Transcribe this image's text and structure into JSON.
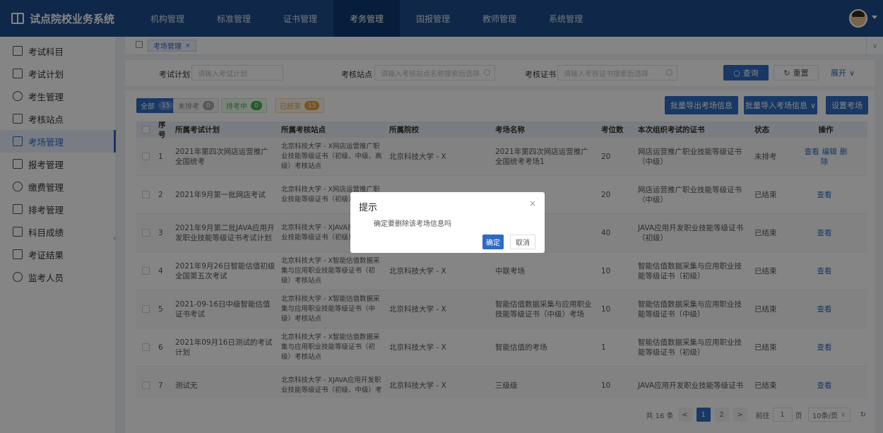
{
  "app": {
    "title": "试点院校业务系统"
  },
  "topnav": [
    "机构管理",
    "标准管理",
    "证书管理",
    "考务管理",
    "国报管理",
    "教师管理",
    "系统管理"
  ],
  "sidebar": [
    "考试科目",
    "考试计划",
    "考生管理",
    "考核站点",
    "考场管理",
    "报考管理",
    "缴费管理",
    "排考管理",
    "科目成绩",
    "考证结果",
    "监考人员"
  ],
  "tabs": {
    "active": "考场管理",
    "close": "×"
  },
  "filter": {
    "plan_label": "考试计划",
    "plan_placeholder": "请输入考试计划",
    "site_label": "考核站点",
    "site_placeholder": "请输入考核站点名称搜索后选择",
    "cert_label": "考核证书",
    "cert_placeholder": "请输入考核证书搜索后选择",
    "search": "查询",
    "reset": "重置",
    "expand": "展开"
  },
  "status_filters": [
    {
      "label": "全部",
      "count": "15"
    },
    {
      "label": "未排考",
      "count": "0"
    },
    {
      "label": "排考中",
      "count": "0"
    },
    {
      "label": "已结束",
      "count": "15"
    }
  ],
  "actions": {
    "export": "批量导出考场信息",
    "import": "批量导入考场信息",
    "setup": "设置考场"
  },
  "table": {
    "headers": [
      "序号",
      "所属考试计划",
      "所属考核站点",
      "所属院校",
      "考场名称",
      "考位数",
      "本次组织考试的证书",
      "状态",
      "操作"
    ],
    "rows": [
      {
        "no": "1",
        "plan": "2021年第四次网店运营推广全国统考",
        "site": "北京科技大学 - X网店运营推广职业技能等级证书（初级、中级、高级）考核站点",
        "school": "北京科技大学 - X",
        "room": "2021年第四次网店运营推广全国统考考场1",
        "seats": "20",
        "cert": "网店运营推广职业技能等级证书（中级）",
        "status": "未排考",
        "ops": [
          "查看",
          "编辑",
          "删除"
        ]
      },
      {
        "no": "2",
        "plan": "2021年9月第一批网店考试",
        "site": "北京科技大学 - X网店运营推广职业技能等级证书（初级）考核站点",
        "school": "",
        "room": "",
        "seats": "20",
        "cert": "网店运营推广职业技能等级证书（中级）",
        "status": "已结束",
        "ops": [
          "查看"
        ]
      },
      {
        "no": "3",
        "plan": "2021年9月第二批JAVA应用开发职业技能等级证书考试计划",
        "site": "北京科技大学 - XJAVA应用开发职业技能等级证书（初级）考核站点",
        "school": "",
        "room": "",
        "seats": "40",
        "cert": "JAVA应用开发职业技能等级证书（初级）",
        "status": "已结束",
        "ops": [
          "查看"
        ]
      },
      {
        "no": "4",
        "plan": "2021年9月26日智能估值初级全国第五次考试",
        "site": "北京科技大学 - X智能估值数据采集与应用职业技能等级证书（初级）考核站点",
        "school": "北京科技大学 - X",
        "room": "中联考场",
        "seats": "10",
        "cert": "智能估值数据采集与应用职业技能等级证书（初级）",
        "status": "已结束",
        "ops": [
          "查看"
        ]
      },
      {
        "no": "5",
        "plan": "2021-09-16日中级智能估值证书考试",
        "site": "北京科技大学 - X智能估值数据采集与应用职业技能等级证书（中级）考核站点",
        "school": "北京科技大学 - X",
        "room": "智能估值数据采集与应用职业技能等级证书（中级）考场",
        "seats": "10",
        "cert": "智能估值数据采集与应用职业技能等级证书（中级）",
        "status": "已结束",
        "ops": [
          "查看"
        ]
      },
      {
        "no": "6",
        "plan": "2021年09月16日测试的考试计划",
        "site": "北京科技大学 - X智能估值数据采集与应用职业技能等级证书（初级）考核站点",
        "school": "北京科技大学 - X",
        "room": "智能估值的考场",
        "seats": "1",
        "cert": "智能估值数据采集与应用职业技能等级证书（初级）",
        "status": "已结束",
        "ops": [
          "查看"
        ]
      },
      {
        "no": "7",
        "plan": "测试无",
        "site": "北京科技大学 - XJAVA应用开发职业技能等级证书（初级、中级）考",
        "school": "北京科技大学 - X",
        "room": "三级级",
        "seats": "10",
        "cert": "JAVA应用开发职业技能等级证书",
        "status": "已结束",
        "ops": [
          "查看"
        ]
      }
    ]
  },
  "pagination": {
    "total": "共 16 条",
    "prev": "<",
    "pages": [
      "1",
      "2"
    ],
    "next": ">",
    "goto": "前往",
    "page_value": "1",
    "page_unit": "页",
    "per_page": "10条/页"
  },
  "dialog": {
    "title": "提示",
    "message": "确定要删除该考场信息吗",
    "ok": "确定",
    "cancel": "取消",
    "close": "×"
  }
}
